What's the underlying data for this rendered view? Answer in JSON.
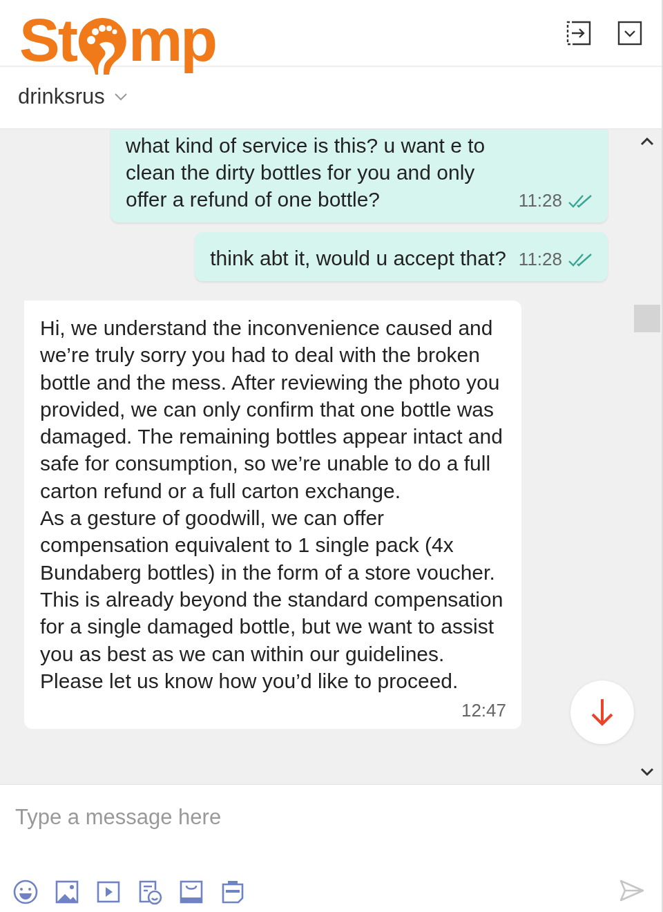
{
  "header": {
    "logo": {
      "before": "St",
      "after": "mp"
    },
    "account": "drinksrus"
  },
  "messages": [
    {
      "outgoing": true,
      "paragraphs": [
        "what kind of service is this? u want e to clean the dirty bottles for you and only offer a refund of one bottle?"
      ],
      "time": "11:28",
      "read": true
    },
    {
      "outgoing": true,
      "paragraphs": [
        "think abt it, would u accept that?"
      ],
      "time": "11:28",
      "read": true
    },
    {
      "outgoing": false,
      "paragraphs": [
        "Hi, we understand the inconvenience caused and we’re truly sorry you had to deal with the broken bottle and the mess. After reviewing the photo you provided, we can only confirm that one bottle was damaged. The remaining bottles appear intact and safe for consumption, so we’re unable to do a full carton refund or a full carton exchange.",
        "As a gesture of goodwill, we can offer compensation equivalent to 1 single pack (4x Bundaberg bottles) in the form of a store voucher. This is already beyond the standard compensation for a single damaged bottle, but we want to assist you as best as we can within our guidelines.",
        "Please let us know how you’d like to proceed."
      ],
      "time": "12:47"
    }
  ],
  "composer": {
    "placeholder": "Type a message here"
  }
}
